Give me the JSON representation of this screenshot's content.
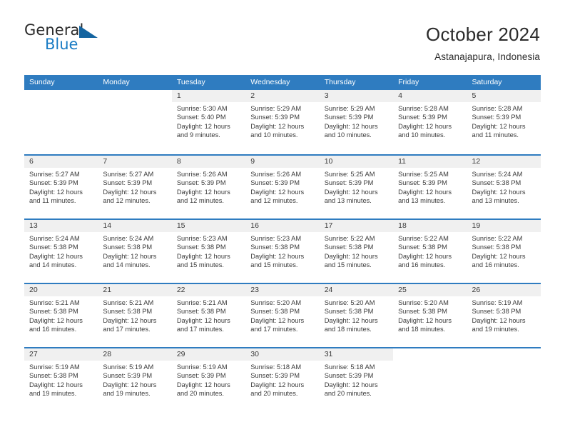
{
  "brand": {
    "name_top": "General",
    "name_bottom": "Blue",
    "accent_color": "#1464a0",
    "blue_text_color": "#1a7cc4",
    "triangle_icon": "triangle-icon"
  },
  "header": {
    "title": "October 2024",
    "subtitle": "Astanajapura, Indonesia"
  },
  "calendar": {
    "header_bg": "#2f7cc0",
    "header_text": "#ffffff",
    "daynum_band_bg": "#f0f0f0",
    "weekday_headers": [
      "Sunday",
      "Monday",
      "Tuesday",
      "Wednesday",
      "Thursday",
      "Friday",
      "Saturday"
    ],
    "weeks": [
      [
        {
          "day": "",
          "sunrise": "",
          "sunset": "",
          "daylight_a": "",
          "daylight_b": ""
        },
        {
          "day": "",
          "sunrise": "",
          "sunset": "",
          "daylight_a": "",
          "daylight_b": ""
        },
        {
          "day": "1",
          "sunrise": "Sunrise: 5:30 AM",
          "sunset": "Sunset: 5:40 PM",
          "daylight_a": "Daylight: 12 hours",
          "daylight_b": "and 9 minutes."
        },
        {
          "day": "2",
          "sunrise": "Sunrise: 5:29 AM",
          "sunset": "Sunset: 5:39 PM",
          "daylight_a": "Daylight: 12 hours",
          "daylight_b": "and 10 minutes."
        },
        {
          "day": "3",
          "sunrise": "Sunrise: 5:29 AM",
          "sunset": "Sunset: 5:39 PM",
          "daylight_a": "Daylight: 12 hours",
          "daylight_b": "and 10 minutes."
        },
        {
          "day": "4",
          "sunrise": "Sunrise: 5:28 AM",
          "sunset": "Sunset: 5:39 PM",
          "daylight_a": "Daylight: 12 hours",
          "daylight_b": "and 10 minutes."
        },
        {
          "day": "5",
          "sunrise": "Sunrise: 5:28 AM",
          "sunset": "Sunset: 5:39 PM",
          "daylight_a": "Daylight: 12 hours",
          "daylight_b": "and 11 minutes."
        }
      ],
      [
        {
          "day": "6",
          "sunrise": "Sunrise: 5:27 AM",
          "sunset": "Sunset: 5:39 PM",
          "daylight_a": "Daylight: 12 hours",
          "daylight_b": "and 11 minutes."
        },
        {
          "day": "7",
          "sunrise": "Sunrise: 5:27 AM",
          "sunset": "Sunset: 5:39 PM",
          "daylight_a": "Daylight: 12 hours",
          "daylight_b": "and 12 minutes."
        },
        {
          "day": "8",
          "sunrise": "Sunrise: 5:26 AM",
          "sunset": "Sunset: 5:39 PM",
          "daylight_a": "Daylight: 12 hours",
          "daylight_b": "and 12 minutes."
        },
        {
          "day": "9",
          "sunrise": "Sunrise: 5:26 AM",
          "sunset": "Sunset: 5:39 PM",
          "daylight_a": "Daylight: 12 hours",
          "daylight_b": "and 12 minutes."
        },
        {
          "day": "10",
          "sunrise": "Sunrise: 5:25 AM",
          "sunset": "Sunset: 5:39 PM",
          "daylight_a": "Daylight: 12 hours",
          "daylight_b": "and 13 minutes."
        },
        {
          "day": "11",
          "sunrise": "Sunrise: 5:25 AM",
          "sunset": "Sunset: 5:39 PM",
          "daylight_a": "Daylight: 12 hours",
          "daylight_b": "and 13 minutes."
        },
        {
          "day": "12",
          "sunrise": "Sunrise: 5:24 AM",
          "sunset": "Sunset: 5:38 PM",
          "daylight_a": "Daylight: 12 hours",
          "daylight_b": "and 13 minutes."
        }
      ],
      [
        {
          "day": "13",
          "sunrise": "Sunrise: 5:24 AM",
          "sunset": "Sunset: 5:38 PM",
          "daylight_a": "Daylight: 12 hours",
          "daylight_b": "and 14 minutes."
        },
        {
          "day": "14",
          "sunrise": "Sunrise: 5:24 AM",
          "sunset": "Sunset: 5:38 PM",
          "daylight_a": "Daylight: 12 hours",
          "daylight_b": "and 14 minutes."
        },
        {
          "day": "15",
          "sunrise": "Sunrise: 5:23 AM",
          "sunset": "Sunset: 5:38 PM",
          "daylight_a": "Daylight: 12 hours",
          "daylight_b": "and 15 minutes."
        },
        {
          "day": "16",
          "sunrise": "Sunrise: 5:23 AM",
          "sunset": "Sunset: 5:38 PM",
          "daylight_a": "Daylight: 12 hours",
          "daylight_b": "and 15 minutes."
        },
        {
          "day": "17",
          "sunrise": "Sunrise: 5:22 AM",
          "sunset": "Sunset: 5:38 PM",
          "daylight_a": "Daylight: 12 hours",
          "daylight_b": "and 15 minutes."
        },
        {
          "day": "18",
          "sunrise": "Sunrise: 5:22 AM",
          "sunset": "Sunset: 5:38 PM",
          "daylight_a": "Daylight: 12 hours",
          "daylight_b": "and 16 minutes."
        },
        {
          "day": "19",
          "sunrise": "Sunrise: 5:22 AM",
          "sunset": "Sunset: 5:38 PM",
          "daylight_a": "Daylight: 12 hours",
          "daylight_b": "and 16 minutes."
        }
      ],
      [
        {
          "day": "20",
          "sunrise": "Sunrise: 5:21 AM",
          "sunset": "Sunset: 5:38 PM",
          "daylight_a": "Daylight: 12 hours",
          "daylight_b": "and 16 minutes."
        },
        {
          "day": "21",
          "sunrise": "Sunrise: 5:21 AM",
          "sunset": "Sunset: 5:38 PM",
          "daylight_a": "Daylight: 12 hours",
          "daylight_b": "and 17 minutes."
        },
        {
          "day": "22",
          "sunrise": "Sunrise: 5:21 AM",
          "sunset": "Sunset: 5:38 PM",
          "daylight_a": "Daylight: 12 hours",
          "daylight_b": "and 17 minutes."
        },
        {
          "day": "23",
          "sunrise": "Sunrise: 5:20 AM",
          "sunset": "Sunset: 5:38 PM",
          "daylight_a": "Daylight: 12 hours",
          "daylight_b": "and 17 minutes."
        },
        {
          "day": "24",
          "sunrise": "Sunrise: 5:20 AM",
          "sunset": "Sunset: 5:38 PM",
          "daylight_a": "Daylight: 12 hours",
          "daylight_b": "and 18 minutes."
        },
        {
          "day": "25",
          "sunrise": "Sunrise: 5:20 AM",
          "sunset": "Sunset: 5:38 PM",
          "daylight_a": "Daylight: 12 hours",
          "daylight_b": "and 18 minutes."
        },
        {
          "day": "26",
          "sunrise": "Sunrise: 5:19 AM",
          "sunset": "Sunset: 5:38 PM",
          "daylight_a": "Daylight: 12 hours",
          "daylight_b": "and 19 minutes."
        }
      ],
      [
        {
          "day": "27",
          "sunrise": "Sunrise: 5:19 AM",
          "sunset": "Sunset: 5:38 PM",
          "daylight_a": "Daylight: 12 hours",
          "daylight_b": "and 19 minutes."
        },
        {
          "day": "28",
          "sunrise": "Sunrise: 5:19 AM",
          "sunset": "Sunset: 5:39 PM",
          "daylight_a": "Daylight: 12 hours",
          "daylight_b": "and 19 minutes."
        },
        {
          "day": "29",
          "sunrise": "Sunrise: 5:19 AM",
          "sunset": "Sunset: 5:39 PM",
          "daylight_a": "Daylight: 12 hours",
          "daylight_b": "and 20 minutes."
        },
        {
          "day": "30",
          "sunrise": "Sunrise: 5:18 AM",
          "sunset": "Sunset: 5:39 PM",
          "daylight_a": "Daylight: 12 hours",
          "daylight_b": "and 20 minutes."
        },
        {
          "day": "31",
          "sunrise": "Sunrise: 5:18 AM",
          "sunset": "Sunset: 5:39 PM",
          "daylight_a": "Daylight: 12 hours",
          "daylight_b": "and 20 minutes."
        },
        {
          "day": "",
          "sunrise": "",
          "sunset": "",
          "daylight_a": "",
          "daylight_b": ""
        },
        {
          "day": "",
          "sunrise": "",
          "sunset": "",
          "daylight_a": "",
          "daylight_b": ""
        }
      ]
    ]
  }
}
